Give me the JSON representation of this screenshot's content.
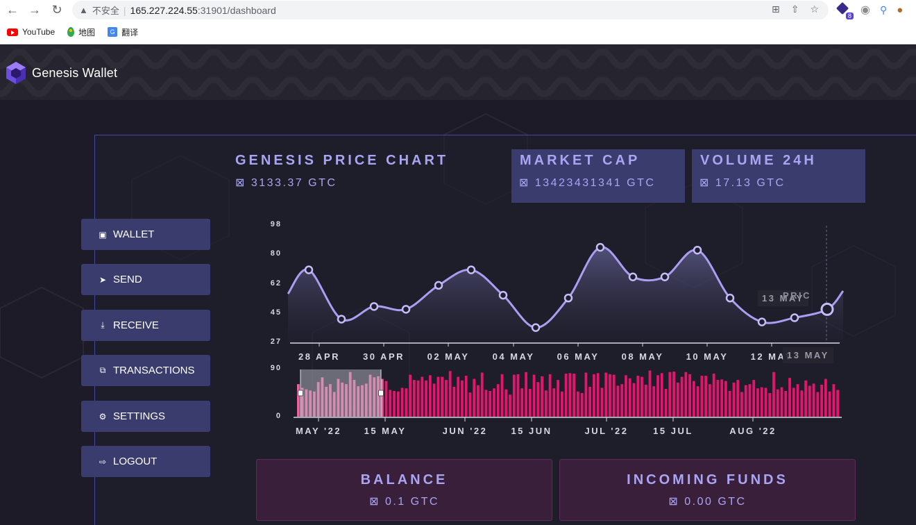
{
  "browser": {
    "back_icon": "back-arrow-icon",
    "insecure_label": "不安全",
    "url_host": "165.227.224.55",
    "url_path": ":31901/dashboard",
    "ext_badge_count": "8"
  },
  "bookmarks": [
    {
      "label": "YouTube"
    },
    {
      "label": "地图"
    },
    {
      "label": "翻译"
    }
  ],
  "app": {
    "title": "Genesis Wallet",
    "currency_symbol": "⊠"
  },
  "stats": {
    "price_title": "GENESIS PRICE CHART",
    "price_value": "⊠ 3133.37 GTC",
    "market_cap_title": "MARKET CAP",
    "market_cap_value": "⊠ 13423431341 GTC",
    "volume_title": "VOLUME 24H",
    "volume_value": "⊠ 17.13 GTC"
  },
  "menu": [
    {
      "label": "WALLET",
      "icon": "wallet-icon"
    },
    {
      "label": "SEND",
      "icon": "send-icon"
    },
    {
      "label": "RECEIVE",
      "icon": "download-icon"
    },
    {
      "label": "TRANSACTIONS",
      "icon": "transactions-icon"
    },
    {
      "label": "SETTINGS",
      "icon": "gear-icon"
    },
    {
      "label": "LOGOUT",
      "icon": "logout-icon"
    }
  ],
  "cards": {
    "balance_title": "BALANCE",
    "balance_value": "⊠ 0.1 GTC",
    "incoming_title": "INCOMING FUNDS",
    "incoming_value": "⊠ 0.00 GTC"
  },
  "tooltip": {
    "label": "PRIC",
    "date": "13 MAY",
    "date_bottom": "13 MAY"
  },
  "chart_data": [
    {
      "type": "line",
      "x": [
        "27 APR",
        "28 APR",
        "29 APR",
        "30 APR",
        "01 MAY",
        "02 MAY",
        "03 MAY",
        "04 MAY",
        "05 MAY",
        "06 MAY",
        "07 MAY",
        "08 MAY",
        "09 MAY",
        "10 MAY",
        "11 MAY",
        "12 MAY",
        "12.5 MAY",
        "13 MAY"
      ],
      "x_ticks": [
        "28 APR",
        "30 APR",
        "02 MAY",
        "04 MAY",
        "06 MAY",
        "08 MAY",
        "10 MAY",
        "12 MAY"
      ],
      "y_ticks": [
        "98",
        "80",
        "62",
        "45",
        "27"
      ],
      "values": [
        60,
        77,
        42,
        51,
        49,
        66,
        77,
        59,
        36,
        57,
        93,
        72,
        72,
        91,
        57,
        40,
        43,
        49
      ],
      "ylim": [
        27,
        98
      ],
      "grid": false
    },
    {
      "type": "bar",
      "x_ticks": [
        "MAY '22",
        "15 MAY",
        "JUN '22",
        "15 JUN",
        "JUL '22",
        "15 JUL",
        "AUG '22"
      ],
      "y_ticks": [
        "90",
        "0"
      ],
      "ylim": [
        0,
        90
      ],
      "values": [
        62,
        55,
        52,
        50,
        48,
        66,
        75,
        57,
        62,
        47,
        72,
        65,
        62,
        85,
        70,
        58,
        60,
        63,
        80,
        75,
        77,
        72,
        68,
        51,
        49,
        48,
        55,
        54,
        80,
        70,
        69,
        76,
        69,
        79,
        63,
        76,
        76,
        70,
        87,
        57,
        76,
        69,
        78,
        46,
        72,
        60,
        84,
        51,
        49,
        54,
        62,
        81,
        52,
        42,
        80,
        81,
        54,
        85,
        53,
        80,
        66,
        77,
        50,
        81,
        54,
        70,
        48,
        82,
        83,
        82,
        48,
        45,
        84,
        57,
        81,
        83,
        55,
        84,
        81,
        80,
        59,
        62,
        79,
        73,
        64,
        78,
        76,
        61,
        88,
        58,
        79,
        83,
        53,
        85,
        86,
        65,
        76,
        85,
        81,
        68,
        58,
        78,
        78,
        62,
        82,
        70,
        71,
        68,
        49,
        65,
        70,
        47,
        60,
        62,
        70,
        54,
        56,
        55,
        45,
        85,
        52,
        56,
        49,
        74,
        55,
        62,
        50,
        69,
        59,
        63,
        47,
        61,
        72,
        48,
        62,
        51
      ]
    }
  ]
}
